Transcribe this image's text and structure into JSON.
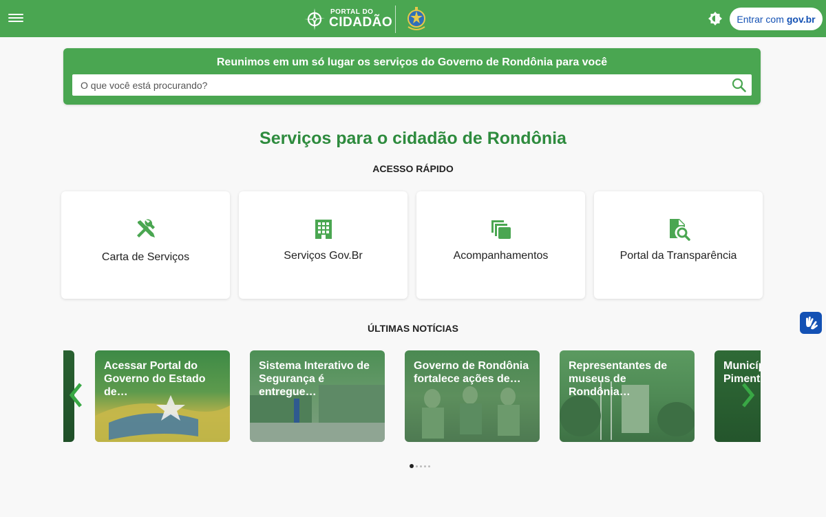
{
  "header": {
    "logo_line1": "PORTAL DO",
    "logo_line2": "CIDADÃO",
    "login_prefix": "Entrar com",
    "login_brand": "gov.br"
  },
  "search": {
    "title": "Reunimos em um só lugar os serviços do Governo de Rondônia para você",
    "placeholder": "O que você está procurando?"
  },
  "main": {
    "title": "Serviços para o cidadão de Rondônia",
    "quick_access_heading": "ACESSO RÁPIDO",
    "quick_access": [
      {
        "label": "Carta de Serviços",
        "icon": "tools-icon"
      },
      {
        "label": "Serviços Gov.Br",
        "icon": "building-icon"
      },
      {
        "label": "Acompanhamentos",
        "icon": "copy-icon"
      },
      {
        "label": "Portal da Transparência",
        "icon": "document-search-icon"
      }
    ],
    "news_heading": "ÚLTIMAS NOTÍCIAS",
    "news": [
      {
        "title": "Acessar Portal do Governo do Estado de…"
      },
      {
        "title": "Sistema Interativo de Segurança é entregue…"
      },
      {
        "title": "Governo de Rondônia fortalece ações de…"
      },
      {
        "title": "Representantes de museus de Rondônia…"
      },
      {
        "title": "Municípios de Pimenteiras…"
      }
    ],
    "carousel_pages": 5,
    "carousel_active": 1
  },
  "colors": {
    "brand_green": "#4aa651",
    "title_green": "#2e8b3e",
    "govbr_blue": "#1351b4"
  }
}
